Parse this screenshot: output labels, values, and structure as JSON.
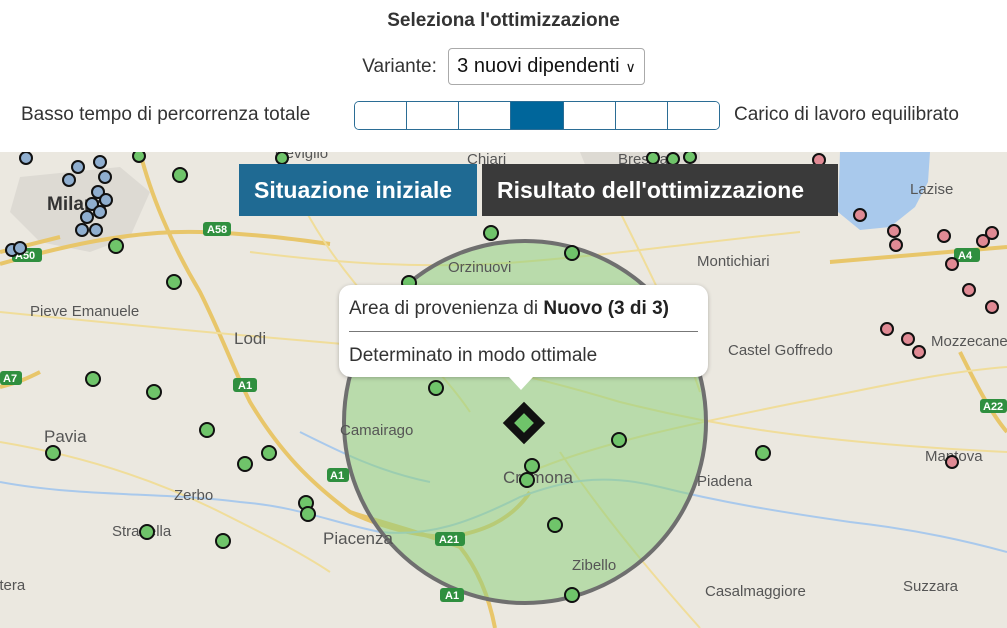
{
  "header": {
    "title": "Seleziona l'ottimizzazione",
    "variant_label": "Variante:",
    "variant_value": "3 nuovi dipendenti",
    "left_objective": "Basso tempo di percorrenza totale",
    "right_objective": "Carico di lavoro equilibrato",
    "slider_segments": 7,
    "slider_active_index": 3,
    "accent_color": "#00669b"
  },
  "tabs": {
    "initial": "Situazione iniziale",
    "result": "Risultato dell'ottimizzazione"
  },
  "popup": {
    "prefix": "Area di provenienza di ",
    "name": "Nuovo (3 di 3)",
    "status": "Determinato in modo ottimale"
  },
  "map": {
    "places": [
      "Treviglio",
      "Chiari",
      "Brescia",
      "Lazise",
      "Milano",
      "Orzinuovi",
      "Montichiari",
      "Pieve Emanuele",
      "Lodi",
      "Castel Goffredo",
      "Mozzecane",
      "Pavia",
      "Camairago",
      "Cremona",
      "Piadena",
      "Mantova",
      "Zerbo",
      "Stradella",
      "Piacenza",
      "Zibello",
      "Casalmaggiore",
      "Suzzara",
      "ltera"
    ],
    "roads": [
      "A58",
      "A4",
      "A1",
      "A7",
      "A22",
      "A21",
      "A50"
    ],
    "marker_colors": {
      "green": "#6fc46a",
      "blue": "#8faecf",
      "pink": "#e08a94",
      "area": "#8fd07f"
    }
  }
}
